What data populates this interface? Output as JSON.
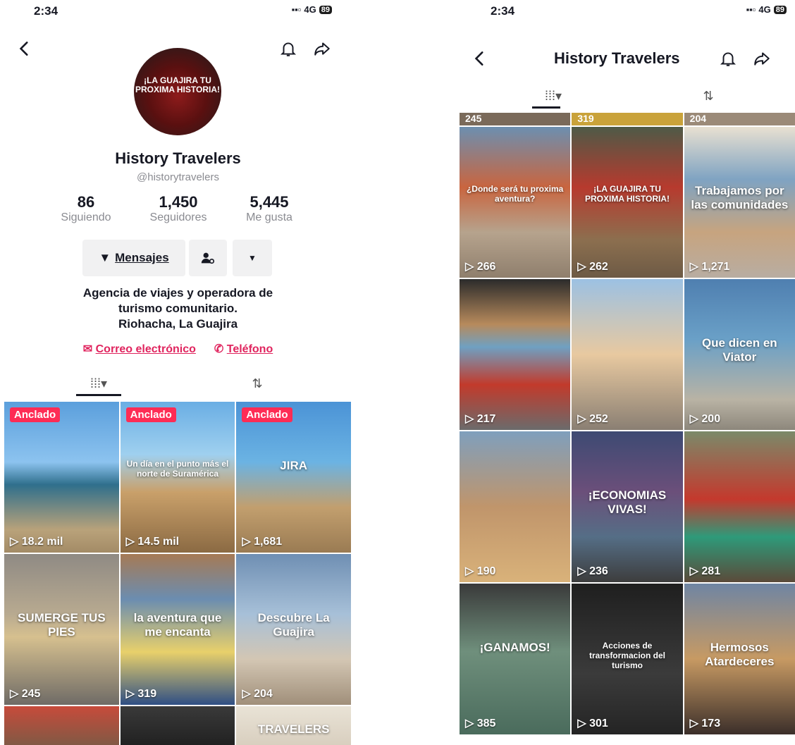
{
  "colors": {
    "accent": "#fe2c55",
    "link": "#e0245e",
    "muted": "#8a8b91"
  },
  "left": {
    "status": {
      "time": "2:34",
      "network": "4G",
      "battery": "89"
    },
    "profile": {
      "avatar_text": "¡LA GUAJIRA TU PROXIMA HISTORIA!",
      "name": "History Travelers",
      "handle": "@historytravelers"
    },
    "stats": [
      {
        "num": "86",
        "label": "Siguiendo"
      },
      {
        "num": "1,450",
        "label": "Seguidores"
      },
      {
        "num": "5,445",
        "label": "Me gusta"
      }
    ],
    "buttons": {
      "message": "Mensajes"
    },
    "bio": [
      "Agencia de viajes y operadora de",
      "turismo comunitario.",
      "Riohacha, La Guajira"
    ],
    "links": {
      "email": "Correo electrónico",
      "phone": "Teléfono"
    },
    "grid": [
      {
        "views": "18.2 mil",
        "pinned": "Anclado",
        "bg": "linear-gradient(180deg,#5b9fdc 0%,#8cc3ef 40%,#2f6f8c 55%,#b9a27a 85%,#a38b66 100%)"
      },
      {
        "views": "14.5 mil",
        "pinned": "Anclado",
        "bg": "linear-gradient(180deg,#6aaee4 0%,#9fd0ef 35%,#c9a06a 60%,#8b6a43 100%)",
        "cap": "Un día en el punto más el norte de Suramérica"
      },
      {
        "views": "1,681",
        "pinned": "Anclado",
        "bg": "linear-gradient(180deg,#4b93d6 0%,#6bb3e3 40%,#c29f6e 70%,#9a7b53 100%)",
        "cap": "JIRA"
      },
      {
        "views": "245",
        "bg": "linear-gradient(180deg,#8f8a84 0%,#b8aa90 40%,#d6c08f 55%,#6f6b66 100%)",
        "cap": "SUMERGE TUS PIES"
      },
      {
        "views": "319",
        "bg": "linear-gradient(180deg,#a67a55 0%,#6b8db0 30%,#e8d06b 65%,#2f4f84 100%)",
        "cap": "la aventura que me encanta"
      },
      {
        "views": "204",
        "bg": "linear-gradient(180deg,#6f8fb3 0%,#a7c0d8 40%,#d3c6b3 70%,#a08f7a 100%)",
        "cap": "Descubre La Guajira"
      },
      {
        "views": "",
        "bg": "linear-gradient(180deg,#c74b3b 0%,#7b5a45 100%)"
      },
      {
        "views": "",
        "bg": "linear-gradient(180deg,#3a3a3a 0%,#1f1f1f 100%)"
      },
      {
        "views": "",
        "bg": "linear-gradient(180deg,#e9e3d6 0%,#d7cdbd 100%)",
        "cap": "TRAVELERS"
      }
    ]
  },
  "right": {
    "status": {
      "time": "2:34",
      "network": "4G",
      "battery": "89"
    },
    "title": "History Travelers",
    "top_row": [
      "245",
      "319",
      "204"
    ],
    "grid": [
      {
        "views": "266",
        "bg": "linear-gradient(180deg,#6c8fb0 0%,#c9653f 40%,#b6a38d 70%,#8f7f6d 100%)",
        "cap": "¿Donde será tu proxima aventura?"
      },
      {
        "views": "262",
        "bg": "linear-gradient(180deg,#4e5a47 0%,#b73a2e 40%,#8c6f4f 75%,#6d5a45 100%)",
        "cap": "¡LA GUAJIRA TU PROXIMA HISTORIA!"
      },
      {
        "views": "1,271",
        "bg": "linear-gradient(180deg,#e8e0d1 0%,#7fa3c2 35%,#c7a47f 70%,#b8ada2 100%)",
        "cap": "Trabajamos por las comunidades"
      },
      {
        "views": "217",
        "bg": "linear-gradient(180deg,#2b2b2b 0%,#b78a5c 30%,#6fa0c2 45%,#c23a2b 70%,#6b6b6b 100%)"
      },
      {
        "views": "252",
        "bg": "linear-gradient(180deg,#9cc1e3 0%,#e8c9a0 50%,#8a7f73 100%)"
      },
      {
        "views": "200",
        "bg": "linear-gradient(180deg,#4f7fb0 0%,#6aa0c7 40%,#b9b3a4 80%,#8d877c 100%)",
        "cap": "Que dicen en Viator"
      },
      {
        "views": "190",
        "bg": "linear-gradient(180deg,#7f9fbd 0%,#c0956b 50%,#d9b27a 100%)"
      },
      {
        "views": "236",
        "bg": "linear-gradient(180deg,#3d4a73 0%,#6b4f7a 40%,#556e86 70%,#3d3d3d 100%)",
        "cap": "¡ECONOMIAS VIVAS!"
      },
      {
        "views": "281",
        "bg": "linear-gradient(180deg,#7b8a6a 0%,#c4392d 45%,#2e9a7a 70%,#5b4a3a 100%)"
      },
      {
        "views": "385",
        "bg": "linear-gradient(180deg,#3a3a3a 0%,#6f8f7c 45%,#4a6b5c 100%)",
        "cap": "¡GANAMOS!"
      },
      {
        "views": "301",
        "bg": "linear-gradient(180deg,#1f1f1f 0%,#3b3b3b 60%,#242424 100%)",
        "cap": "Acciones de transformacion del turismo"
      },
      {
        "views": "173",
        "bg": "linear-gradient(180deg,#6f85a3 0%,#c79a63 50%,#3b2f2a 100%)",
        "cap": "Hermosos Atardeceres"
      }
    ]
  }
}
